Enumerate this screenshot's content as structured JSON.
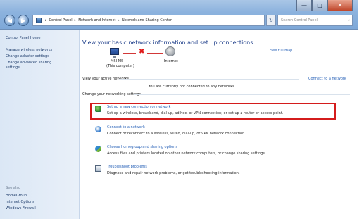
{
  "window": {
    "controls": {
      "minimize": "—",
      "maximize": "□",
      "close": "✕"
    }
  },
  "nav": {
    "back_icon": "back-arrow-icon",
    "forward_icon": "forward-arrow-icon",
    "address_segments": [
      "Control Panel",
      "Network and Internet",
      "Network and Sharing Center"
    ],
    "address_separator": "▸",
    "refresh_symbol": "↻",
    "search_placeholder": "Search Control Panel",
    "search_icon": "⌕"
  },
  "sidebar": {
    "items": [
      {
        "label": "Control Panel Home"
      },
      {
        "label": "Manage wireless networks"
      },
      {
        "label": "Change adapter settings"
      },
      {
        "label": "Change advanced sharing"
      },
      {
        "label": "settings"
      }
    ],
    "see_also_title": "See also",
    "see_also": [
      {
        "label": "HomeGroup"
      },
      {
        "label": "Internet Options"
      },
      {
        "label": "Windows Firewall"
      }
    ]
  },
  "main": {
    "heading": "View your basic network information and set up connections",
    "see_full_map": "See full map",
    "map": {
      "computer_name": "MSI-MS",
      "computer_sub": "(This computer)",
      "internet_label": "Internet"
    },
    "active_networks_title": "View your active networks",
    "not_connected": "You are currently not connected to any networks.",
    "connect_to_network": "Connect to a network",
    "change_settings_title": "Change your networking settings",
    "tasks": [
      {
        "icon": "setup-connection-icon",
        "link": "Set up a new connection or network",
        "desc": "Set up a wireless, broadband, dial-up, ad hoc, or VPN connection; or set up a router or access point."
      },
      {
        "icon": "connect-network-icon",
        "link": "Connect to a network",
        "desc": "Connect or reconnect to a wireless, wired, dial-up, or VPN network connection."
      },
      {
        "icon": "homegroup-icon",
        "link": "Choose homegroup and sharing options",
        "desc": "Access files and printers located on other network computers, or change sharing settings."
      },
      {
        "icon": "troubleshoot-icon",
        "link": "Troubleshoot problems",
        "desc": "Diagnose and repair network problems, or get troubleshooting information."
      }
    ]
  },
  "colors": {
    "link": "#2a63b8",
    "heading": "#1e3e8a",
    "highlight": "#d41c1c",
    "disconnect": "#e01b1b"
  }
}
